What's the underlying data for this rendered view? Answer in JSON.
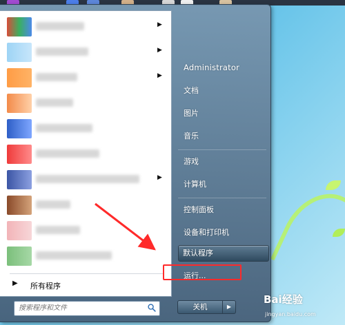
{
  "start_menu": {
    "left_pane": {
      "all_programs": "所有程序",
      "search_placeholder": "搜索程序和文件"
    },
    "right_pane": {
      "items": [
        "Administrator",
        "文档",
        "图片",
        "音乐",
        "游戏",
        "计算机",
        "控制面板",
        "设备和打印机",
        "默认程序",
        "运行..."
      ],
      "highlighted": "默认程序"
    },
    "shutdown_label": "关机"
  },
  "watermark": {
    "brand": "Bai经验",
    "url": "jingyan.baidu.com"
  },
  "colors": {
    "annotation_red": "#ff2a2a",
    "menu_blue": "#5f7c93"
  }
}
